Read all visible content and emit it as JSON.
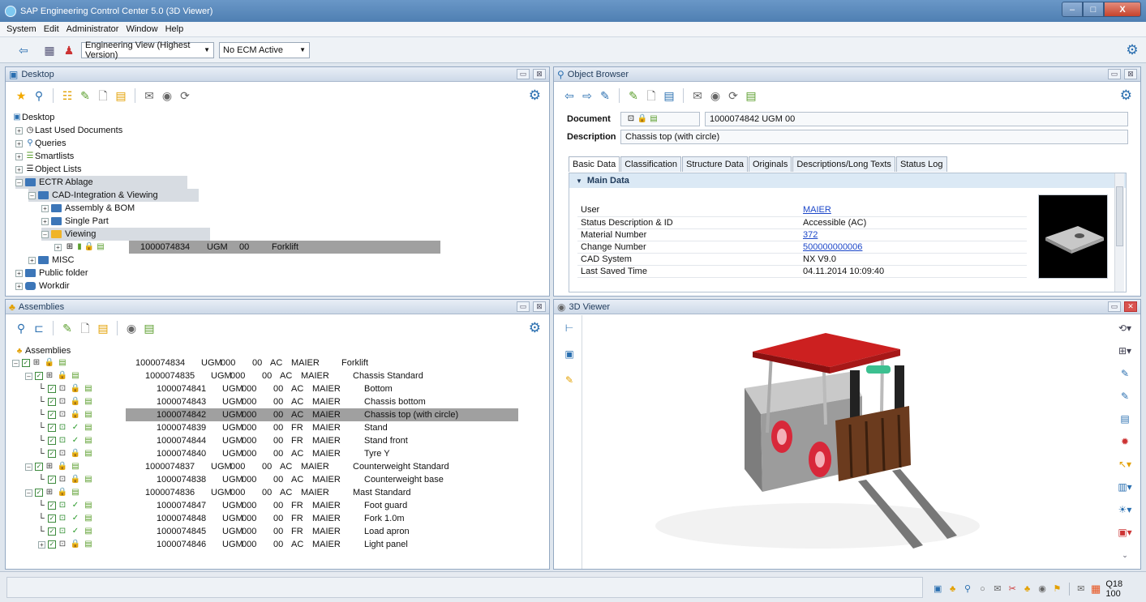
{
  "window": {
    "title": "SAP Engineering Control Center 5.0 (3D Viewer)",
    "min": "–",
    "max": "□",
    "close": "X"
  },
  "menu": [
    "System",
    "Edit",
    "Administrator",
    "Window",
    "Help"
  ],
  "toolbar": {
    "view_select": "Engineering View (Highest Version)",
    "ecm_select": "No ECM Active"
  },
  "desktop": {
    "title": "Desktop",
    "tree": [
      {
        "label": "Desktop",
        "level": 0
      },
      {
        "label": "Last Used Documents",
        "level": 1
      },
      {
        "label": "Queries",
        "level": 1
      },
      {
        "label": "Smartlists",
        "level": 1
      },
      {
        "label": "Object Lists",
        "level": 1
      },
      {
        "label": "ECTR Ablage",
        "level": 1
      },
      {
        "label": "CAD-Integration & Viewing",
        "level": 2
      },
      {
        "label": "Assembly & BOM",
        "level": 3
      },
      {
        "label": "Single Part",
        "level": 3
      },
      {
        "label": "Viewing",
        "level": 3
      },
      {
        "label": "",
        "level": 4
      },
      {
        "label": "MISC",
        "level": 2
      },
      {
        "label": "Public folder",
        "level": 1
      },
      {
        "label": "Workdir",
        "level": 1
      }
    ],
    "selected_doc": {
      "number": "1000074834",
      "type": "UGM",
      "version": "00",
      "desc": "Forklift"
    }
  },
  "object_browser": {
    "title": "Object Browser",
    "document_label": "Document",
    "document_value": "1000074842 UGM 00",
    "description_label": "Description",
    "description_value": "Chassis top (with circle)",
    "tabs": [
      "Basic Data",
      "Classification",
      "Structure Data",
      "Originals",
      "Descriptions/Long Texts",
      "Status Log"
    ],
    "section": "Main Data",
    "fields": [
      {
        "key": "User",
        "value": "MAIER",
        "link": true
      },
      {
        "key": "Status Description & ID",
        "value": "Accessible (AC)",
        "link": false
      },
      {
        "key": "Material Number",
        "value": "372",
        "link": true
      },
      {
        "key": "Change Number",
        "value": "500000000006",
        "link": true
      },
      {
        "key": "CAD System",
        "value": "NX V9.0",
        "link": false
      },
      {
        "key": "Last Saved Time",
        "value": "04.11.2014 10:09:40",
        "link": false
      }
    ]
  },
  "assemblies": {
    "title": "Assemblies",
    "root": "Assemblies",
    "rows": [
      {
        "number": "1000074834",
        "type": "UGM",
        "var": "000",
        "ver": "00",
        "status": "AC",
        "user": "MAIER",
        "desc": "Forklift",
        "level": 0
      },
      {
        "number": "1000074835",
        "type": "UGM",
        "var": "000",
        "ver": "00",
        "status": "AC",
        "user": "MAIER",
        "desc": "Chassis Standard",
        "level": 1
      },
      {
        "number": "1000074841",
        "type": "UGM",
        "var": "000",
        "ver": "00",
        "status": "AC",
        "user": "MAIER",
        "desc": "Bottom",
        "level": 2
      },
      {
        "number": "1000074843",
        "type": "UGM",
        "var": "000",
        "ver": "00",
        "status": "AC",
        "user": "MAIER",
        "desc": "Chassis bottom",
        "level": 2
      },
      {
        "number": "1000074842",
        "type": "UGM",
        "var": "000",
        "ver": "00",
        "status": "AC",
        "user": "MAIER",
        "desc": "Chassis top (with circle)",
        "level": 2,
        "selected": true
      },
      {
        "number": "1000074839",
        "type": "UGM",
        "var": "000",
        "ver": "00",
        "status": "FR",
        "user": "MAIER",
        "desc": "Stand",
        "level": 2
      },
      {
        "number": "1000074844",
        "type": "UGM",
        "var": "000",
        "ver": "00",
        "status": "FR",
        "user": "MAIER",
        "desc": "Stand front",
        "level": 2
      },
      {
        "number": "1000074840",
        "type": "UGM",
        "var": "000",
        "ver": "00",
        "status": "AC",
        "user": "MAIER",
        "desc": "Tyre Y",
        "level": 2
      },
      {
        "number": "1000074837",
        "type": "UGM",
        "var": "000",
        "ver": "00",
        "status": "AC",
        "user": "MAIER",
        "desc": "Counterweight Standard",
        "level": 1
      },
      {
        "number": "1000074838",
        "type": "UGM",
        "var": "000",
        "ver": "00",
        "status": "AC",
        "user": "MAIER",
        "desc": "Counterweight base",
        "level": 2
      },
      {
        "number": "1000074836",
        "type": "UGM",
        "var": "000",
        "ver": "00",
        "status": "AC",
        "user": "MAIER",
        "desc": "Mast Standard",
        "level": 1
      },
      {
        "number": "1000074847",
        "type": "UGM",
        "var": "000",
        "ver": "00",
        "status": "FR",
        "user": "MAIER",
        "desc": "Foot guard",
        "level": 2
      },
      {
        "number": "1000074848",
        "type": "UGM",
        "var": "000",
        "ver": "00",
        "status": "FR",
        "user": "MAIER",
        "desc": "Fork 1.0m",
        "level": 2
      },
      {
        "number": "1000074845",
        "type": "UGM",
        "var": "000",
        "ver": "00",
        "status": "FR",
        "user": "MAIER",
        "desc": "Load apron",
        "level": 2
      },
      {
        "number": "1000074846",
        "type": "UGM",
        "var": "000",
        "ver": "00",
        "status": "AC",
        "user": "MAIER",
        "desc": "Light panel",
        "level": 2
      }
    ]
  },
  "viewer": {
    "title": "3D Viewer"
  },
  "status": {
    "system": "Q18 100",
    "chevron": "⌄"
  },
  "colors": {
    "accent": "#2a6fb0",
    "selection": "#a0a0a0",
    "link": "#1c47c9"
  }
}
